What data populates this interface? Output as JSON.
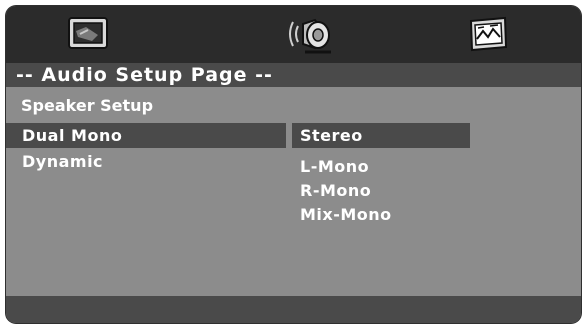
{
  "header": {
    "tabs": [
      {
        "name": "video",
        "icon": "monitor-icon"
      },
      {
        "name": "audio",
        "icon": "speaker-icon",
        "active": true
      },
      {
        "name": "preference",
        "icon": "picture-frame-icon"
      }
    ]
  },
  "page_title": "-- Audio Setup Page --",
  "section_title": "Speaker Setup",
  "menu": {
    "items": [
      {
        "label": "Dual Mono",
        "selected": true
      },
      {
        "label": "Dynamic",
        "selected": false
      }
    ]
  },
  "options": [
    {
      "label": "Stereo",
      "selected": true
    },
    {
      "label": "L-Mono",
      "selected": false
    },
    {
      "label": "R-Mono",
      "selected": false
    },
    {
      "label": "Mix-Mono",
      "selected": false
    }
  ],
  "colors": {
    "frame": "#8c8c8c",
    "bar": "#2b2b2b",
    "highlight": "#4a4a4a",
    "text": "#ffffff"
  }
}
